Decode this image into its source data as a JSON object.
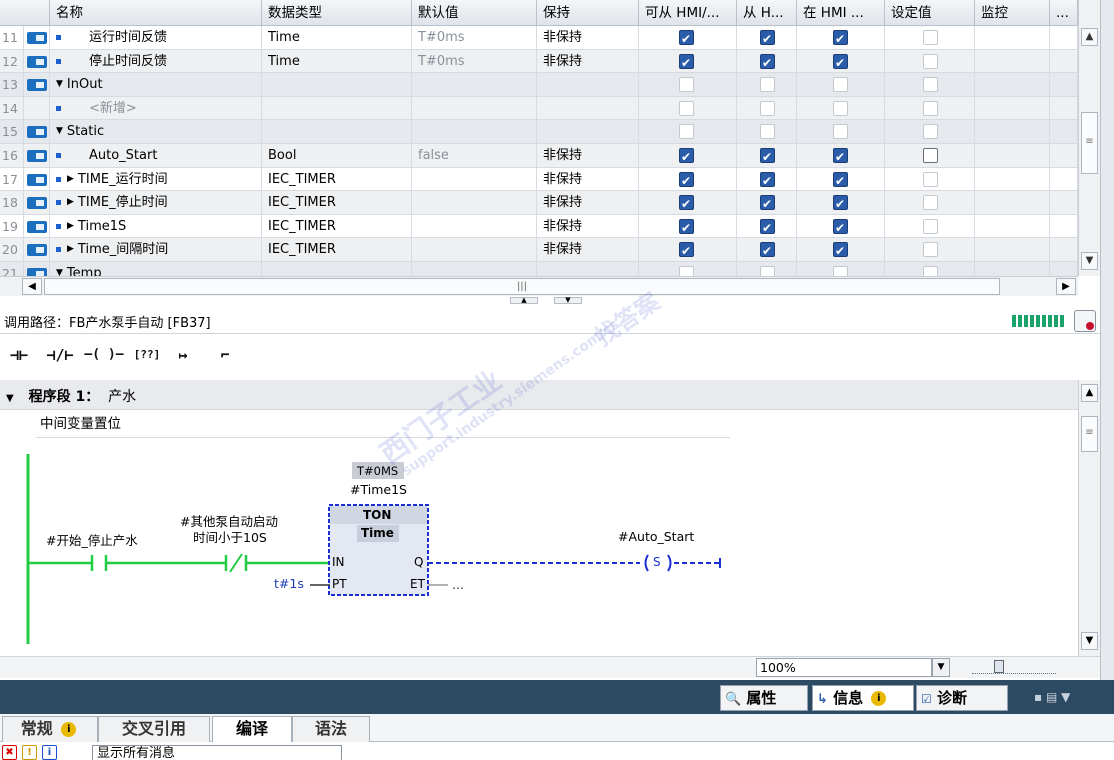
{
  "table": {
    "headers": [
      "名称",
      "数据类型",
      "默认值",
      "保持",
      "可从 HMI/...",
      "从 H...",
      "在 HMI ...",
      "设定值",
      "监控",
      "..."
    ],
    "rows": [
      {
        "num": "11",
        "name": "运行时间反馈",
        "type": "Time",
        "default": "T#0ms",
        "retain": "非保持",
        "hmi1": true,
        "hmi2": true,
        "hmi3": true,
        "set": false,
        "kind": "var"
      },
      {
        "num": "12",
        "name": "停止时间反馈",
        "type": "Time",
        "default": "T#0ms",
        "retain": "非保持",
        "hmi1": true,
        "hmi2": true,
        "hmi3": true,
        "set": false,
        "kind": "var"
      },
      {
        "num": "13",
        "name": "InOut",
        "type": "",
        "default": "",
        "retain": "",
        "hmi1": false,
        "hmi2": false,
        "hmi3": false,
        "set": false,
        "kind": "section"
      },
      {
        "num": "14",
        "name": "<新增>",
        "type": "",
        "default": "",
        "retain": "",
        "hmi1": false,
        "hmi2": false,
        "hmi3": false,
        "set": false,
        "kind": "add"
      },
      {
        "num": "15",
        "name": "Static",
        "type": "",
        "default": "",
        "retain": "",
        "hmi1": false,
        "hmi2": false,
        "hmi3": false,
        "set": false,
        "kind": "section"
      },
      {
        "num": "16",
        "name": "Auto_Start",
        "type": "Bool",
        "default": "false",
        "retain": "非保持",
        "hmi1": true,
        "hmi2": true,
        "hmi3": true,
        "set": false,
        "kind": "var",
        "setPlain": true
      },
      {
        "num": "17",
        "name": "TIME_运行时间",
        "type": "IEC_TIMER",
        "default": "",
        "retain": "非保持",
        "hmi1": true,
        "hmi2": true,
        "hmi3": true,
        "set": false,
        "kind": "struct"
      },
      {
        "num": "18",
        "name": "TIME_停止时间",
        "type": "IEC_TIMER",
        "default": "",
        "retain": "非保持",
        "hmi1": true,
        "hmi2": true,
        "hmi3": true,
        "set": false,
        "kind": "struct"
      },
      {
        "num": "19",
        "name": "Time1S",
        "type": "IEC_TIMER",
        "default": "",
        "retain": "非保持",
        "hmi1": true,
        "hmi2": true,
        "hmi3": true,
        "set": false,
        "kind": "struct"
      },
      {
        "num": "20",
        "name": "Time_间隔时间",
        "type": "IEC_TIMER",
        "default": "",
        "retain": "非保持",
        "hmi1": true,
        "hmi2": true,
        "hmi3": true,
        "set": false,
        "kind": "struct"
      },
      {
        "num": "21",
        "name": "Temp",
        "type": "",
        "default": "",
        "retain": "",
        "hmi1": false,
        "hmi2": false,
        "hmi3": false,
        "set": false,
        "kind": "section"
      }
    ]
  },
  "callpath": {
    "label": "调用路径：FB产水泵手自动 [FB37]"
  },
  "toolbar": {
    "no_contact": "⊣⊢",
    "nc_contact": "⊣/⊢",
    "coil": "–( )–",
    "box": "[??]",
    "branch_open": "↦",
    "branch_close": "⌐"
  },
  "network": {
    "title_prefix": "程序段 1：",
    "title": "产水",
    "comment": "中间变量置位",
    "contact1_label": "#开始_停止产水",
    "contact2_label_l1": "#其他泵自动启动",
    "contact2_label_l2": "时间小于10S",
    "timer_value": "T#0MS",
    "timer_instance": "#Time1S",
    "timer_type": "TON",
    "timer_datatype": "Time",
    "pin_in": "IN",
    "pin_pt": "PT",
    "pin_q": "Q",
    "pin_et": "ET",
    "pt_value": "t#1s",
    "et_value": "...",
    "coil_label": "#Auto_Start",
    "coil_type": "S"
  },
  "zoom": {
    "value": "100%"
  },
  "inspector": {
    "tab_properties": "属性",
    "tab_info": "信息",
    "tab_diag": "诊断",
    "info_badge": "i"
  },
  "subtabs": {
    "general": "常规",
    "general_badge": "i",
    "xref": "交叉引用",
    "compile": "编译",
    "syntax": "语法"
  },
  "filter": {
    "value": "显示所有消息"
  },
  "watermark": {
    "line1": "西门子工业",
    "line2": "support.industry.siemens.com/cs",
    "line3": "找答案"
  },
  "colors": {
    "power_rail": "#22cc44",
    "wire_active": "#22cc44",
    "wire_inactive": "#1a2fd0",
    "header_bg": "#dfe4ea",
    "inspector_bg": "#2d4a63"
  }
}
